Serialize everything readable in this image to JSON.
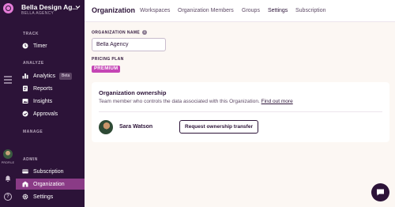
{
  "workspace": {
    "name": "Bella Design Ag...",
    "subtitle": "BELLA AGENCY"
  },
  "rail": {
    "profile_label": "PROFILE",
    "help_glyph": "?"
  },
  "sidebar": {
    "sections": {
      "track": "TRACK",
      "analyze": "ANALYZE",
      "manage": "MANAGE",
      "admin": "ADMIN"
    },
    "items": [
      {
        "label": "Timer",
        "icon": "clock-icon"
      },
      {
        "label": "Analytics",
        "icon": "bar-chart-icon",
        "badge": "Beta"
      },
      {
        "label": "Reports",
        "icon": "document-icon"
      },
      {
        "label": "Insights",
        "icon": "image-icon"
      },
      {
        "label": "Approvals",
        "icon": "check-circle-icon"
      },
      {
        "label": "Subscription",
        "icon": "credit-card-icon"
      },
      {
        "label": "Organization",
        "icon": "building-icon"
      },
      {
        "label": "Settings",
        "icon": "gear-icon"
      }
    ]
  },
  "header": {
    "title": "Organization",
    "tabs": [
      "Workspaces",
      "Organization Members",
      "Groups",
      "Settings",
      "Subscription"
    ],
    "active_tab": "Settings"
  },
  "form": {
    "org_name_label": "ORGANIZATION NAME",
    "org_name_value": "Bella Agency",
    "plan_label": "PRICING PLAN",
    "plan_value": "PREMIUM"
  },
  "ownership": {
    "title": "Organization ownership",
    "description": "Team member who controls the data associated with this Organization.",
    "link": "Find out more",
    "owner_name": "Sara Watson",
    "transfer_button": "Request ownership transfer"
  },
  "colors": {
    "sidebar_bg": "#2c1338",
    "active_item": "#8a3b86",
    "premium": "#c545b5",
    "page_bg": "#fcf7f3"
  }
}
